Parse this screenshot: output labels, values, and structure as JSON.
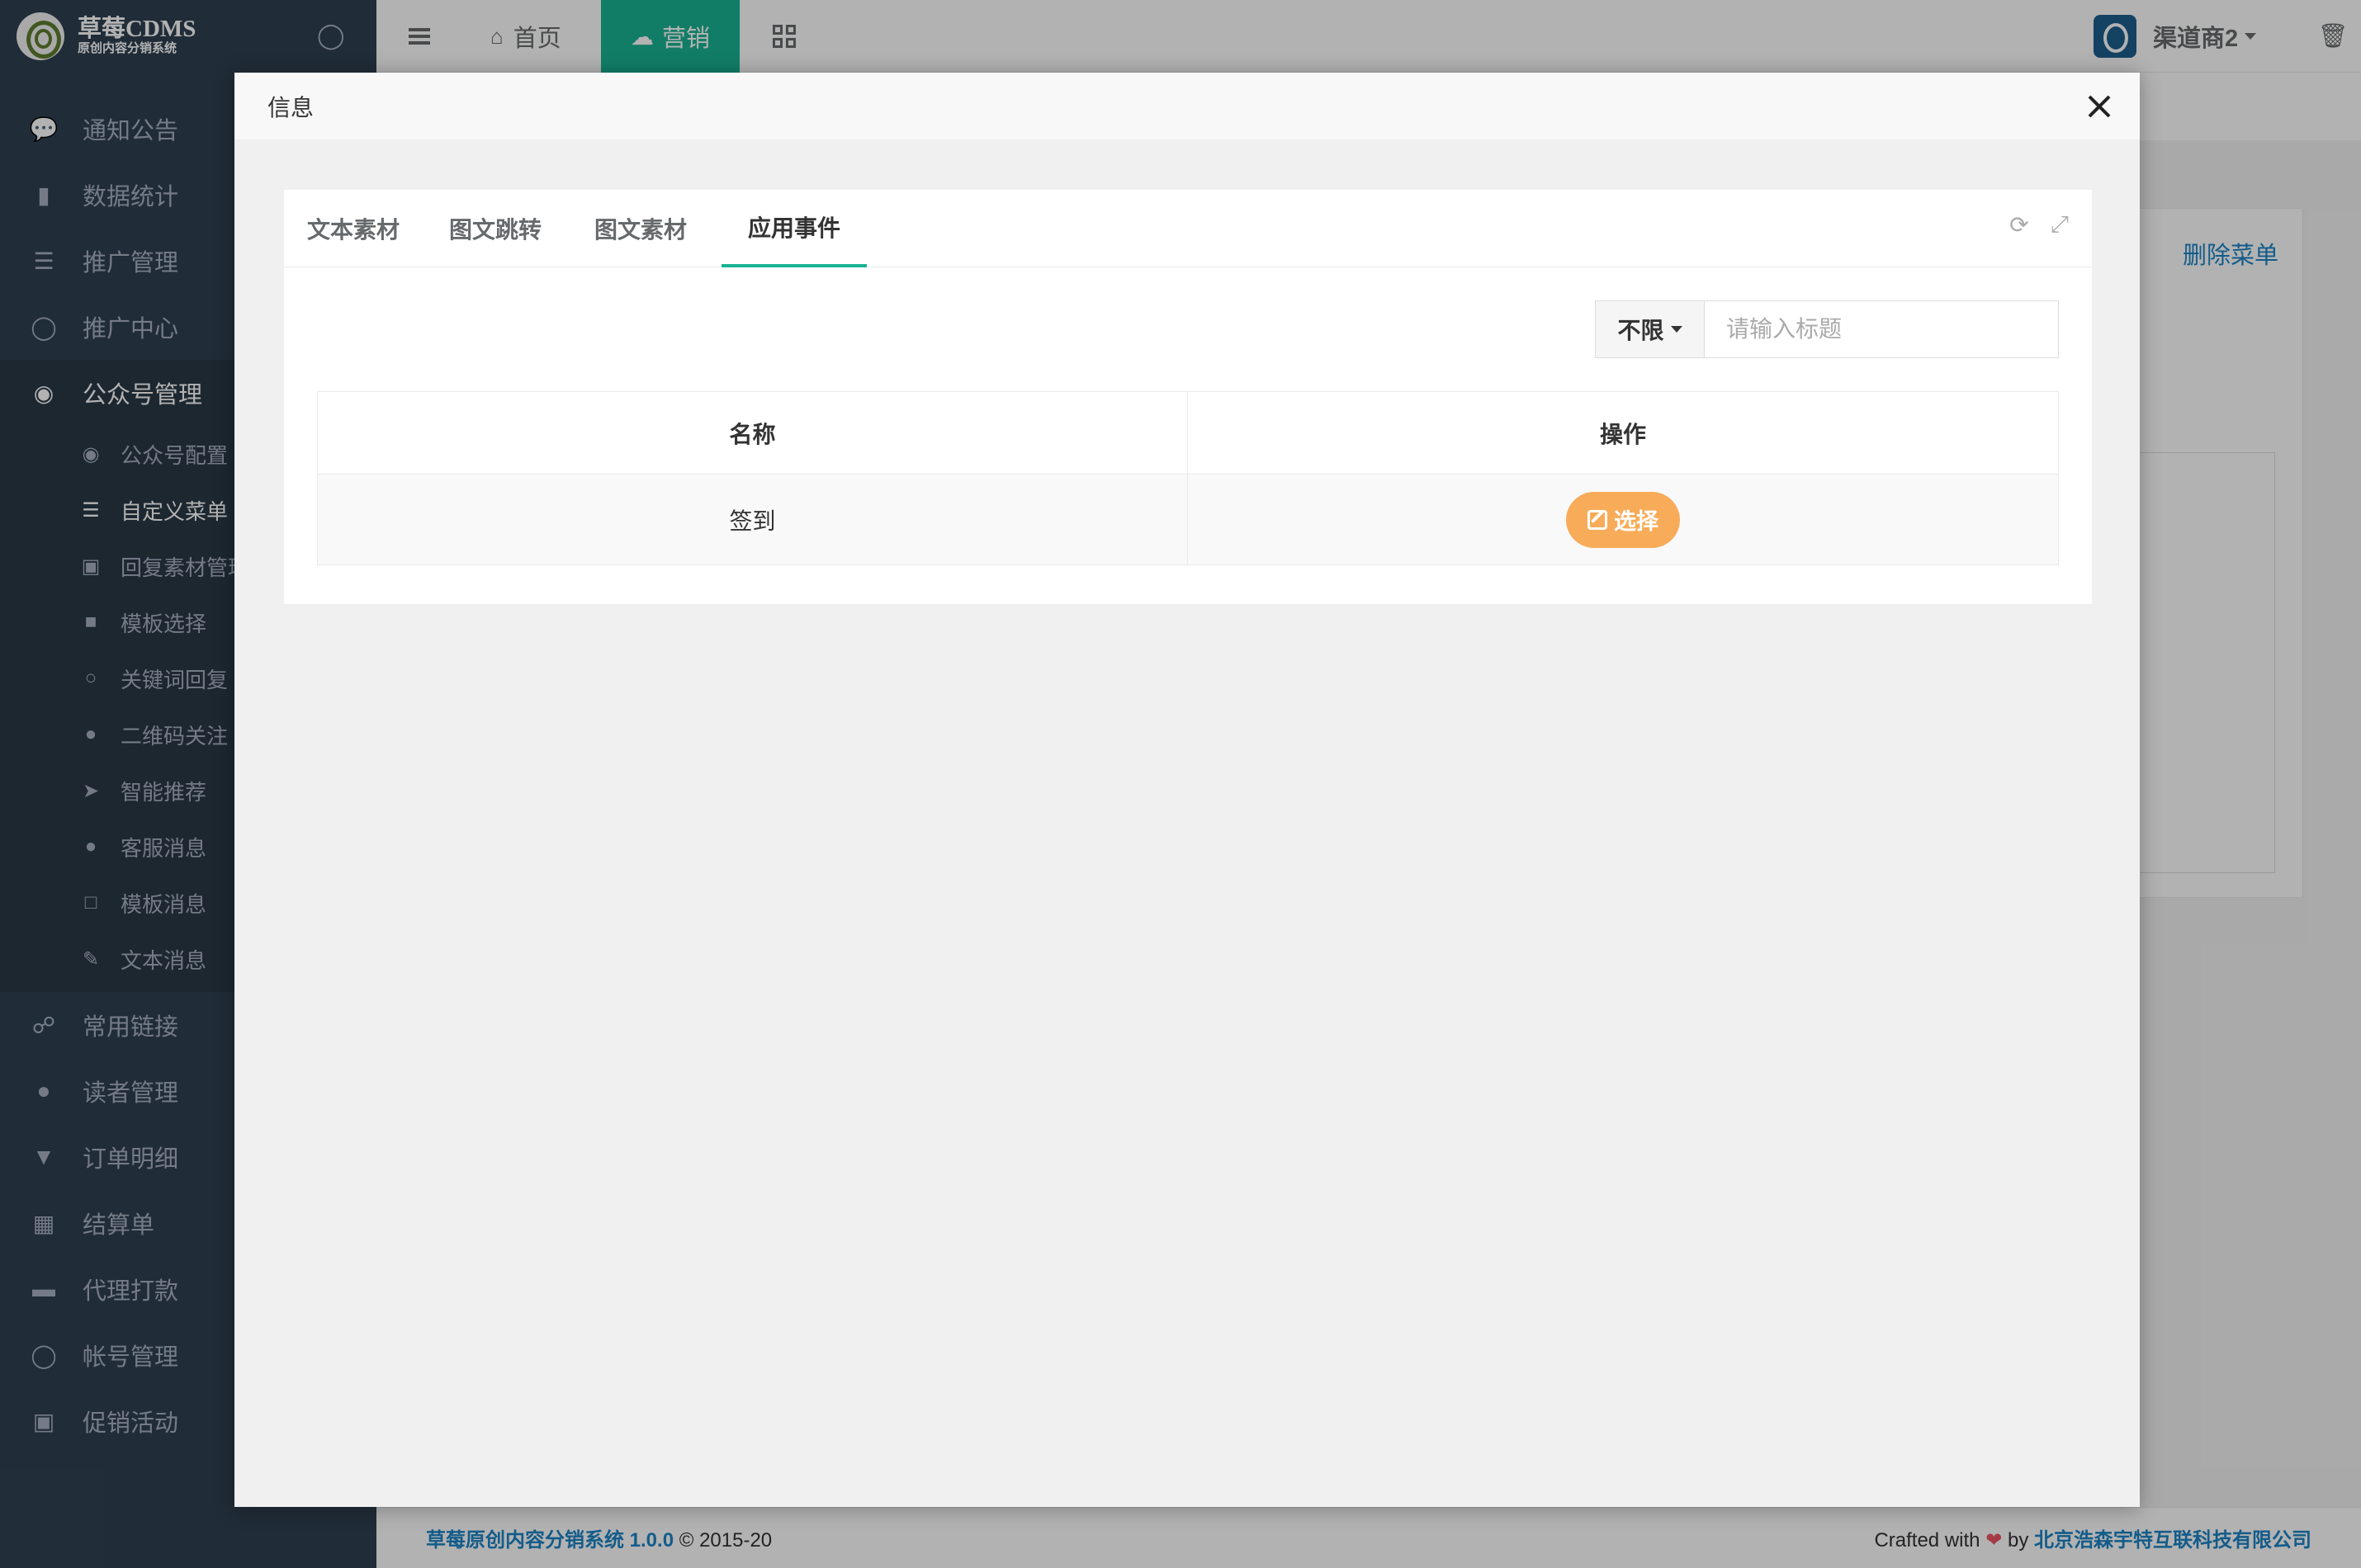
{
  "brand": {
    "title": "草莓CDMS",
    "subtitle": "原创内容分销系统"
  },
  "topbar": {
    "home_label": "首页",
    "marketing_label": "营销",
    "user_name": "渠道商2"
  },
  "sidebar": {
    "items": [
      {
        "label": "通知公告",
        "icon": "comment-icon"
      },
      {
        "label": "数据统计",
        "icon": "bar-chart-icon"
      },
      {
        "label": "推广管理",
        "icon": "list-icon"
      },
      {
        "label": "推广中心",
        "icon": "user-circle-icon"
      },
      {
        "label": "公众号管理",
        "icon": "wechat-icon"
      }
    ],
    "subitems": [
      {
        "label": "公众号配置",
        "icon": "comments-icon"
      },
      {
        "label": "自定义菜单",
        "icon": "list-ul-icon"
      },
      {
        "label": "回复素材管理",
        "icon": "image-icon"
      },
      {
        "label": "模板选择",
        "icon": "puzzle-icon"
      },
      {
        "label": "关键词回复",
        "icon": "chat-icon"
      },
      {
        "label": "二维码关注",
        "icon": "comment-icon"
      },
      {
        "label": "智能推荐",
        "icon": "send-icon"
      },
      {
        "label": "客服消息",
        "icon": "user-icon"
      },
      {
        "label": "模板消息",
        "icon": "file-icon"
      },
      {
        "label": "文本消息",
        "icon": "edit-icon"
      }
    ],
    "items_after": [
      {
        "label": "常用链接",
        "icon": "link-icon"
      },
      {
        "label": "读者管理",
        "icon": "user-secret-icon"
      },
      {
        "label": "订单明细",
        "icon": "cart-icon"
      },
      {
        "label": "结算单",
        "icon": "calculator-icon"
      },
      {
        "label": "代理打款",
        "icon": "credit-card-icon"
      },
      {
        "label": "帐号管理",
        "icon": "user-icon"
      },
      {
        "label": "促销活动",
        "icon": "briefcase-icon"
      }
    ]
  },
  "background": {
    "delete_menu_link": "删除菜单"
  },
  "footer": {
    "product": "草莓原创内容分销系统 1.0.0",
    "copyright": "© 2015-20",
    "crafted": "Crafted with",
    "by": "by",
    "company": "北京浩森宇特互联科技有限公司"
  },
  "modal": {
    "title": "信息",
    "tabs": [
      "文本素材",
      "图文跳转",
      "图文素材",
      "应用事件"
    ],
    "active_tab": "应用事件",
    "filter_dropdown": "不限",
    "search_placeholder": "请输入标题",
    "table": {
      "headers": [
        "名称",
        "操作"
      ],
      "rows": [
        {
          "name": "签到",
          "action": "选择"
        }
      ]
    }
  },
  "colors": {
    "sidebar_bg": "#2f4050",
    "accent": "#1ab394",
    "select_button": "#f8ac59",
    "link": "#1c84c6"
  }
}
